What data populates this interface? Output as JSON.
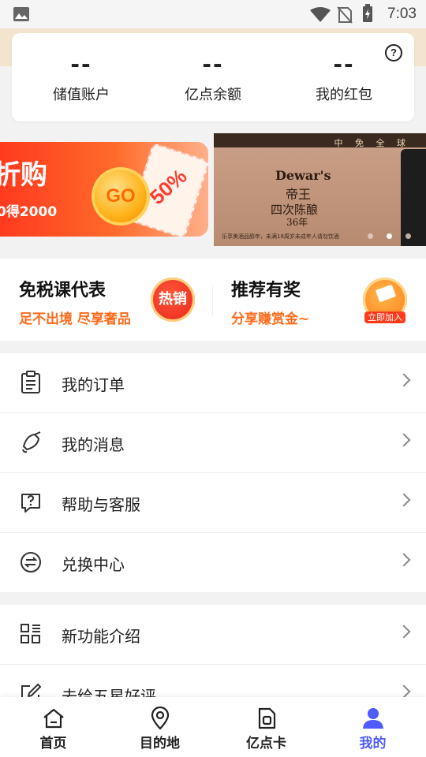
{
  "status_bar": {
    "time": "7:03"
  },
  "account": {
    "balance_value": "--",
    "balance_label": "储值账户",
    "points_value": "--",
    "points_label": "亿点余额",
    "redpacket_value": "--",
    "redpacket_label": "我的红包",
    "help_glyph": "?"
  },
  "banners": {
    "left": {
      "title": "折购",
      "subtitle": "0得2000",
      "coin_text": "GO",
      "ticket_text": "50%"
    },
    "right": {
      "top_text": "中 免 全 球",
      "brand": "Dewar's",
      "line1": "帝王",
      "line2": "四次陈酿",
      "line3": "36年",
      "footer": "乐享美酒品醇年，未满18周岁未成年人请勿饮酒"
    },
    "active_dot": 1
  },
  "promos": [
    {
      "title": "免税课代表",
      "subtitle": "足不出境 尽享奢品",
      "badge": "热销"
    },
    {
      "title": "推荐有奖",
      "subtitle": "分享赚赏金~",
      "badge": "立即加入"
    }
  ],
  "menu_group1": [
    {
      "label": "我的订单",
      "icon": "clipboard-icon"
    },
    {
      "label": "我的消息",
      "icon": "bell-icon"
    },
    {
      "label": "帮助与客服",
      "icon": "question-chat-icon"
    },
    {
      "label": "兑换中心",
      "icon": "exchange-icon"
    }
  ],
  "menu_group2": [
    {
      "label": "新功能介绍",
      "icon": "grid-list-icon"
    },
    {
      "label": "去给五星好评",
      "icon": "edit-icon"
    }
  ],
  "tabbar": [
    {
      "label": "首页",
      "icon": "home-icon",
      "active": false
    },
    {
      "label": "目的地",
      "icon": "location-pin-icon",
      "active": false
    },
    {
      "label": "亿点卡",
      "icon": "card-icon",
      "active": false
    },
    {
      "label": "我的",
      "icon": "user-icon",
      "active": true
    }
  ],
  "colors": {
    "accent": "#4f5bff",
    "promo_orange": "#ff6a1a",
    "hero_bg": "#f3e4cd"
  }
}
